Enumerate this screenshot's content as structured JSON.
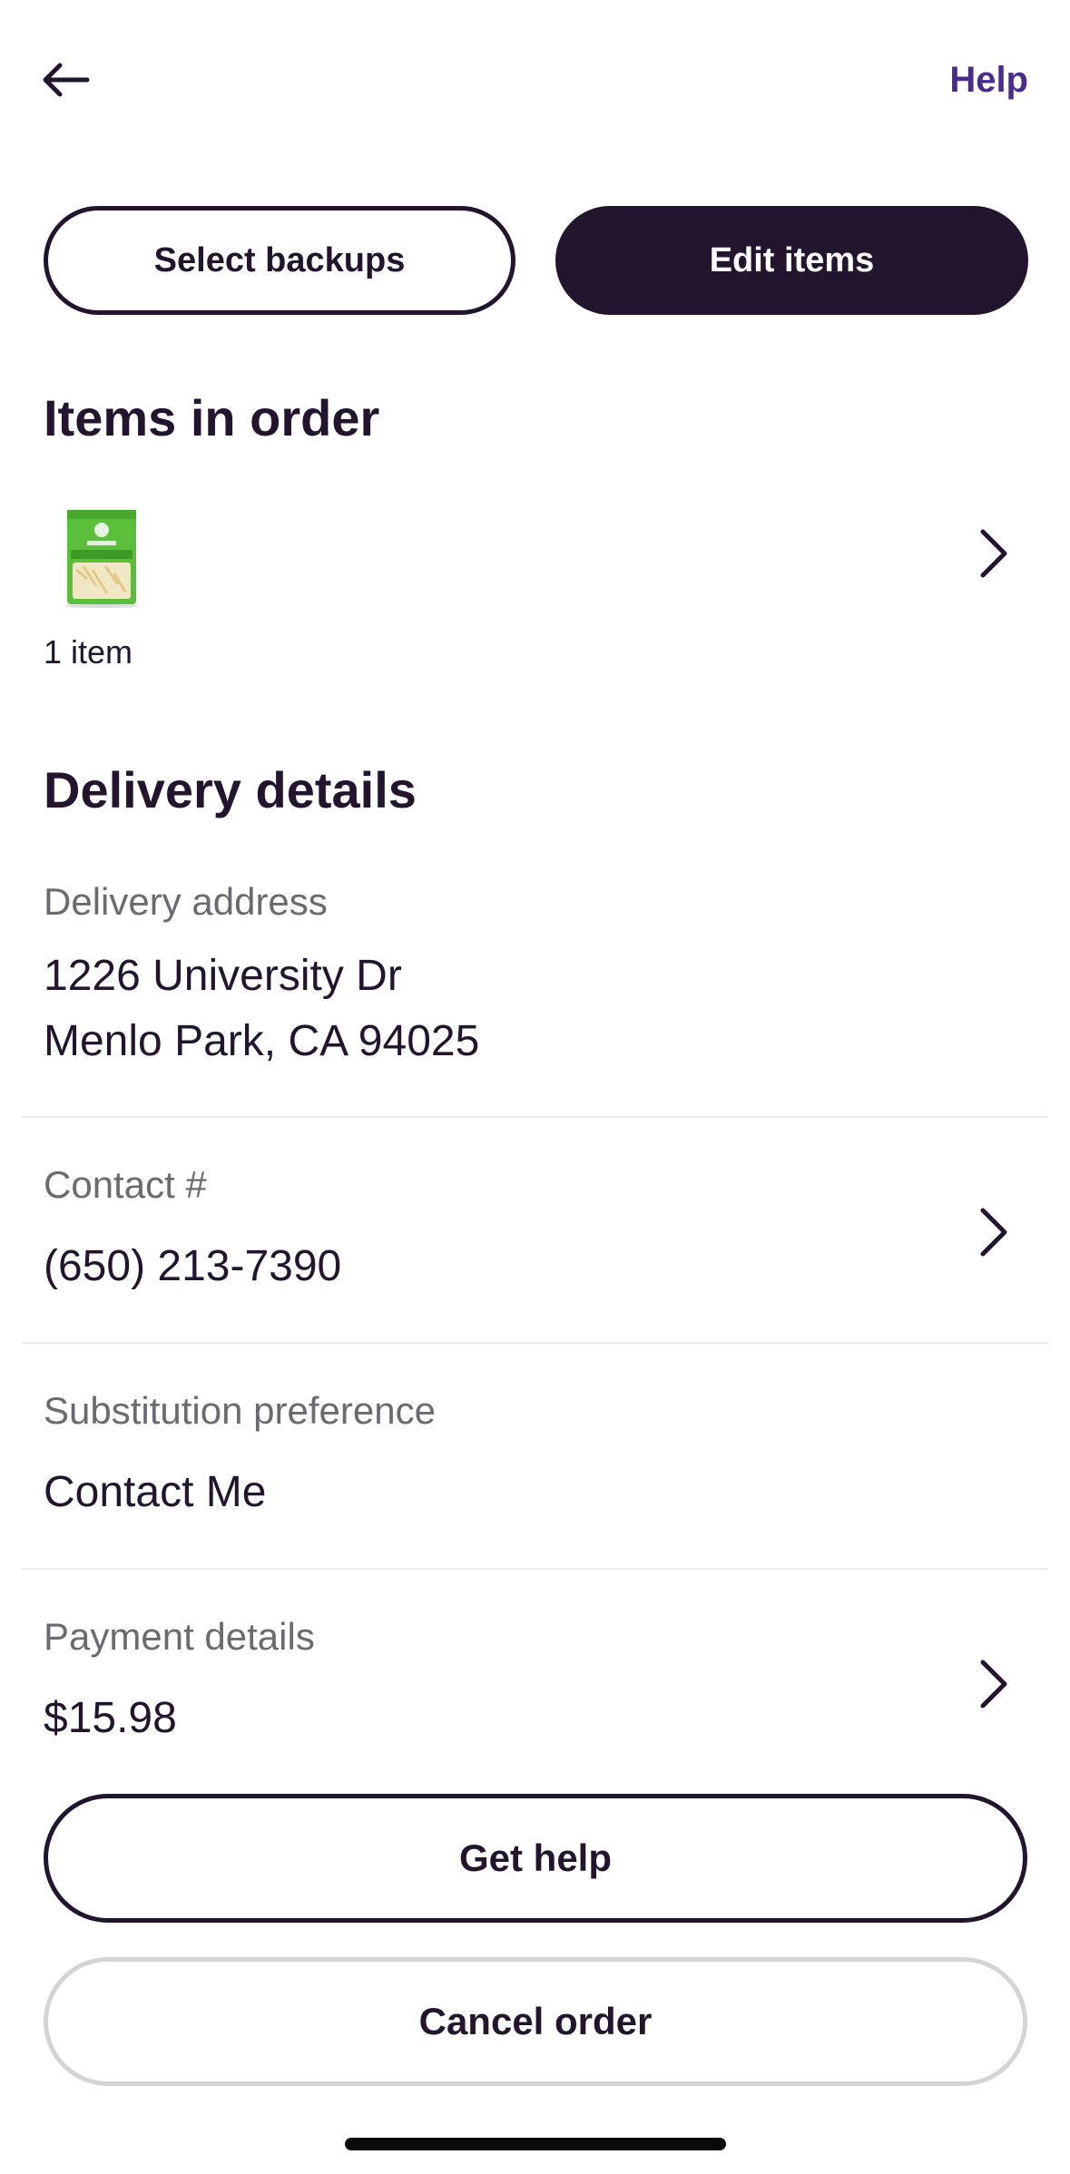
{
  "header": {
    "back_icon": "arrow-left-icon",
    "help_label": "Help"
  },
  "actions": {
    "select_backups_label": "Select backups",
    "edit_items_label": "Edit items"
  },
  "items_section": {
    "title": "Items in order",
    "thumbnail_icon": "shredded-cheese-bag-image",
    "count_label": "1 item"
  },
  "delivery": {
    "title": "Delivery details",
    "address": {
      "label": "Delivery address",
      "line1": "1226 University Dr",
      "line2": "Menlo Park, CA 94025"
    },
    "contact": {
      "label": "Contact #",
      "value": "(650) 213-7390"
    },
    "substitution": {
      "label": "Substitution preference",
      "value": "Contact Me"
    },
    "payment": {
      "label": "Payment details",
      "value": "$15.98"
    }
  },
  "footer": {
    "get_help_label": "Get help",
    "cancel_order_label": "Cancel order"
  },
  "colors": {
    "primary_dark": "#24152f",
    "accent_purple": "#4a2c8c",
    "muted_label": "#6c6a70",
    "divider": "#ececee",
    "cancel_border": "#d4d3d6"
  }
}
